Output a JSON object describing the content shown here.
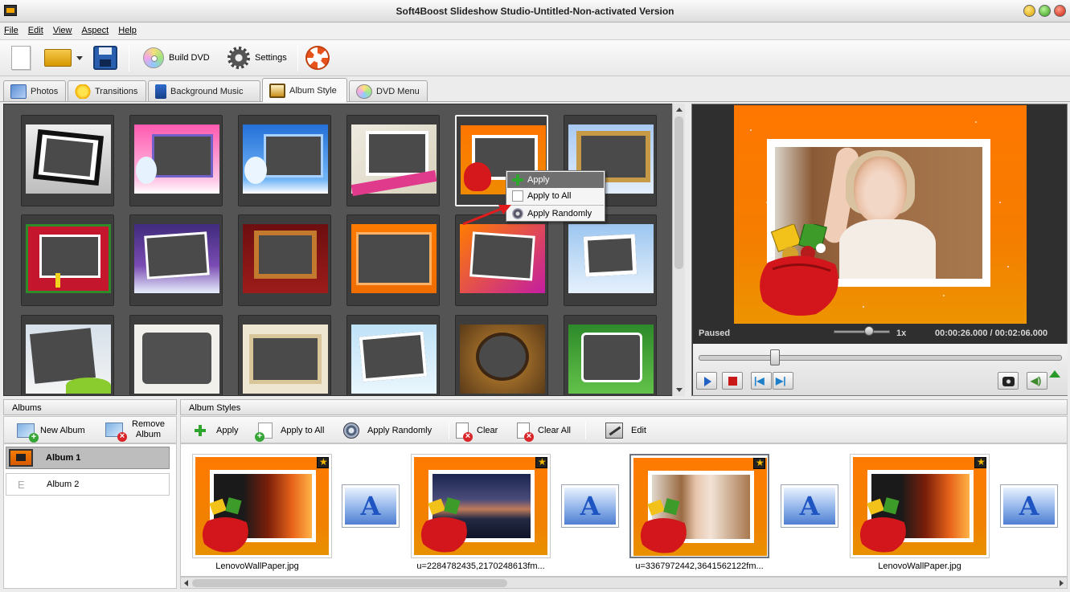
{
  "window": {
    "title": "Soft4Boost Slideshow Studio-Untitled-Non-activated Version"
  },
  "menu": {
    "items": [
      "File",
      "Edit",
      "View",
      "Aspect",
      "Help"
    ]
  },
  "toolbar": {
    "build_dvd_label": "Build DVD",
    "settings_label": "Settings"
  },
  "tabs": [
    {
      "label": "Photos",
      "icon": "photos-icon"
    },
    {
      "label": "Transitions",
      "icon": "star-icon"
    },
    {
      "label": "Background Music",
      "icon": "music-note-icon"
    },
    {
      "label": "Album Style",
      "icon": "album-frame-icon",
      "active": true
    },
    {
      "label": "DVD Menu",
      "icon": "dvd-disc-icon"
    }
  ],
  "context_menu": {
    "items": [
      "Apply",
      "Apply to All",
      "Apply Randomly"
    ],
    "highlighted": "Apply"
  },
  "preview": {
    "status": "Paused",
    "speed": "1x",
    "current_time": "00:00:26.000",
    "time_separator": "/",
    "total_time": "00:02:06.000",
    "seek_fraction": 0.21
  },
  "albums_panel": {
    "title": "Albums",
    "new_album_label": "New Album",
    "remove_album_label_line1": "Remove",
    "remove_album_label_line2": "Album",
    "albums": [
      {
        "name": "Album 1",
        "selected": true
      },
      {
        "name": "Album 2",
        "selected": false
      }
    ]
  },
  "styles_panel": {
    "title": "Album Styles",
    "apply_label": "Apply",
    "apply_all_label": "Apply to All",
    "apply_random_label": "Apply Randomly",
    "clear_label": "Clear",
    "clear_all_label": "Clear All",
    "edit_label": "Edit",
    "slides": [
      {
        "name": "LenovoWallPaper.jpg"
      },
      {
        "name": "u=2284782435,2170248613fm..."
      },
      {
        "name": "u=3367972442,3641562122fm..."
      },
      {
        "name": "LenovoWallPaper.jpg"
      }
    ]
  }
}
